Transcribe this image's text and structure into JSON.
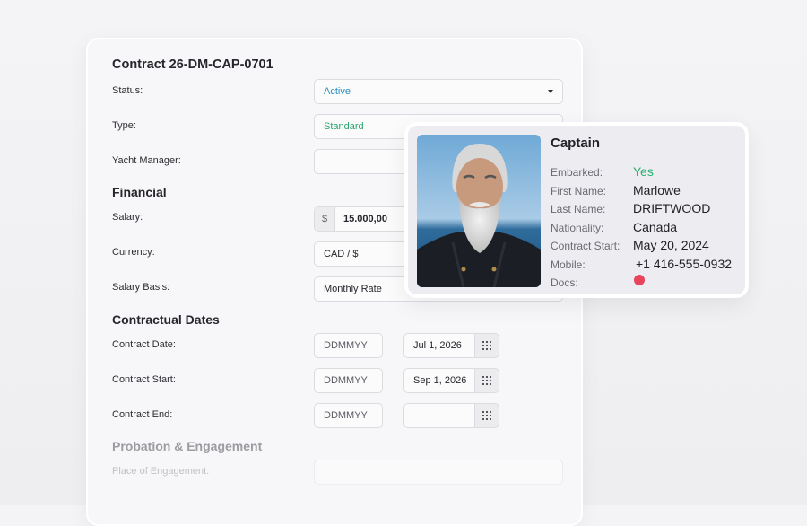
{
  "contract": {
    "title": "Contract 26-DM-CAP-0701",
    "status_label": "Status:",
    "status_value": "Active",
    "type_label": "Type:",
    "type_value": "Standard",
    "yacht_manager_label": "Yacht Manager:",
    "yacht_manager_value": ""
  },
  "financial": {
    "title": "Financial",
    "salary_label": "Salary:",
    "salary_prefix": "$",
    "salary_value": "15.000,00",
    "currency_label": "Currency:",
    "currency_value": "CAD / $",
    "salary_basis_label": "Salary Basis:",
    "salary_basis_value": "Monthly Rate"
  },
  "dates": {
    "title": "Contractual Dates",
    "placeholder": "DDMMYY",
    "contract_date_label": "Contract Date:",
    "contract_date_value": "Jul 1, 2026",
    "contract_start_label": "Contract Start:",
    "contract_start_value": "Sep 1, 2026",
    "contract_end_label": "Contract End:",
    "contract_end_value": ""
  },
  "probation": {
    "title": "Probation & Engagement",
    "place_label": "Place of Engagement:",
    "place_value": ""
  },
  "crew_card": {
    "title": "Captain",
    "embarked_label": "Embarked:",
    "embarked_value": "Yes",
    "first_name_label": "First Name:",
    "first_name_value": "Marlowe",
    "last_name_label": "Last Name:",
    "last_name_value": "DRIFTWOOD",
    "nationality_label": "Nationality:",
    "nationality_value": "Canada",
    "contract_start_label": "Contract Start:",
    "contract_start_value": "May 20, 2024",
    "mobile_label": "Mobile:",
    "mobile_value": "+1 416-555-0932",
    "docs_label": "Docs:"
  },
  "colors": {
    "status_blue": "#2a8fc0",
    "type_green": "#2aa56b",
    "embarked_green": "#2ab070",
    "docs_red": "#e8445e"
  },
  "icons": [
    "chevron-down-icon",
    "calendar-grid-icon",
    "status-dot-icon"
  ]
}
